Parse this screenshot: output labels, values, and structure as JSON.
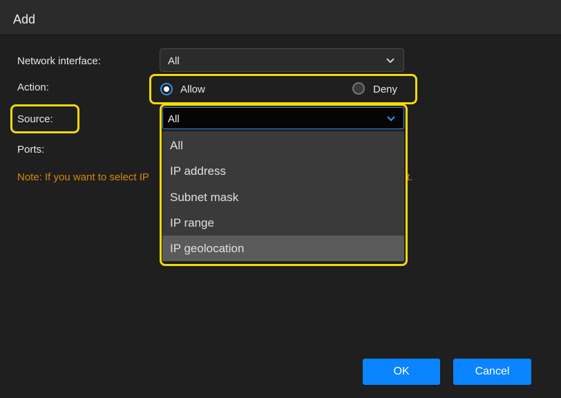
{
  "dialog": {
    "title": "Add"
  },
  "form": {
    "network_interface": {
      "label": "Network interface:",
      "value": "All"
    },
    "action": {
      "label": "Action:",
      "options": [
        {
          "label": "Allow",
          "selected": true
        },
        {
          "label": "Deny",
          "selected": false
        }
      ]
    },
    "source": {
      "label": "Source:",
      "value": "All",
      "options": [
        "All",
        "IP address",
        "Subnet mask",
        "IP range",
        "IP geolocation"
      ],
      "hovered_option": "IP geolocation"
    },
    "ports": {
      "label": "Ports:"
    },
    "note": {
      "visible_start": "Note: If you want to select IP",
      "visible_end": "t."
    }
  },
  "buttons": {
    "ok": "OK",
    "cancel": "Cancel"
  },
  "colors": {
    "accent": "#0a84ff",
    "highlight": "#f5d90a",
    "note": "#d4880f",
    "background": "#1f1f1f"
  }
}
